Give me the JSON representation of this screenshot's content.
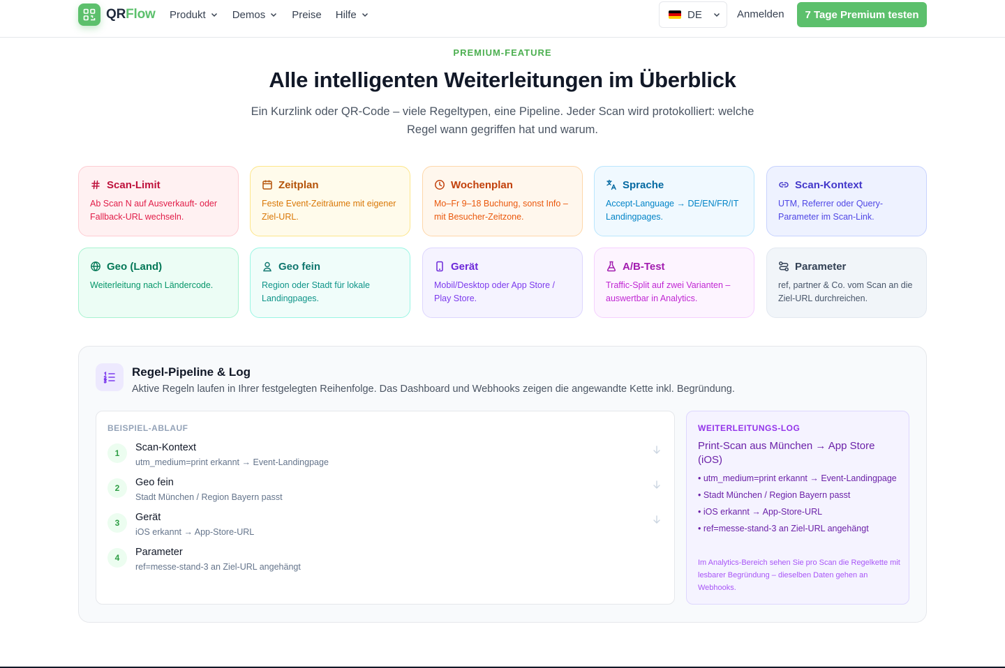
{
  "header": {
    "logo_left": "QR",
    "logo_right": "Flow",
    "nav": [
      {
        "label": "Produkt",
        "has_dropdown": true
      },
      {
        "label": "Demos",
        "has_dropdown": true
      },
      {
        "label": "Preise",
        "has_dropdown": false
      },
      {
        "label": "Hilfe",
        "has_dropdown": true
      }
    ],
    "language": "DE",
    "login": "Anmelden",
    "cta": "7 Tage Premium testen"
  },
  "hero": {
    "eyebrow": "PREMIUM-FEATURE",
    "title": "Alle intelligenten Weiterleitungen im Überblick",
    "subtitle": "Ein Kurzlink oder QR-Code – viele Regeltypen, eine Pipeline. Jeder Scan wird protokolliert: welche Regel wann gegriffen hat und warum."
  },
  "cards": [
    {
      "title": "Scan-Limit",
      "desc": "Ab Scan N auf Ausverkauft- oder Fallback-URL wechseln.",
      "icon": "hash-icon"
    },
    {
      "title": "Zeitplan",
      "desc": "Feste Event-Zeiträume mit eigener Ziel-URL.",
      "icon": "calendar-icon"
    },
    {
      "title": "Wochenplan",
      "desc": "Mo–Fr 9–18 Buchung, sonst Info – mit Besucher-Zeitzone.",
      "icon": "clock-icon"
    },
    {
      "title": "Sprache",
      "desc": "Accept-Language → DE/EN/FR/IT Landingpages.",
      "icon": "translate-icon"
    },
    {
      "title": "Scan-Kontext",
      "desc": "UTM, Referrer oder Query-Parameter im Scan-Link.",
      "icon": "link-icon"
    },
    {
      "title": "Geo (Land)",
      "desc": "Weiterleitung nach Ländercode.",
      "icon": "globe-icon"
    },
    {
      "title": "Geo fein",
      "desc": "Region oder Stadt für lokale Landingpages.",
      "icon": "location-user-icon"
    },
    {
      "title": "Gerät",
      "desc": "Mobil/Desktop oder App Store / Play Store.",
      "icon": "smartphone-icon"
    },
    {
      "title": "A/B-Test",
      "desc": "Traffic-Split auf zwei Varianten – auswertbar in Analytics.",
      "icon": "flask-icon"
    },
    {
      "title": "Parameter",
      "desc": "ref, partner & Co. vom Scan an die Ziel-URL durchreichen.",
      "icon": "route-icon"
    }
  ],
  "colors": {
    "brand": "#5cc06c",
    "card_themes": [
      {
        "bg": "#fff1f2",
        "border": "#fecdd3",
        "title": "#be123c",
        "text": "#e11d48"
      },
      {
        "bg": "#fffbeb",
        "border": "#fde68a",
        "title": "#b45309",
        "text": "#d97706"
      },
      {
        "bg": "#fff7ed",
        "border": "#fed7aa",
        "title": "#c2410c",
        "text": "#ea580c"
      },
      {
        "bg": "#f0f9ff",
        "border": "#bae6fd",
        "title": "#0369a1",
        "text": "#0284c7"
      },
      {
        "bg": "#eef2ff",
        "border": "#c7d2fe",
        "title": "#4338ca",
        "text": "#4f46e5"
      },
      {
        "bg": "#ecfdf5",
        "border": "#a7f3d0",
        "title": "#047857",
        "text": "#059669"
      },
      {
        "bg": "#f0fdfa",
        "border": "#99f6e4",
        "title": "#0f766e",
        "text": "#0d9488"
      },
      {
        "bg": "#f5f3ff",
        "border": "#ddd6fe",
        "title": "#6d28d9",
        "text": "#7c3aed"
      },
      {
        "bg": "#fdf4ff",
        "border": "#f5d0fe",
        "title": "#a21caf",
        "text": "#c026d3"
      },
      {
        "bg": "#f1f5f9",
        "border": "#e2e8f0",
        "title": "#334155",
        "text": "#475569"
      }
    ]
  },
  "pipeline": {
    "title": "Regel-Pipeline & Log",
    "desc": "Aktive Regeln laufen in Ihrer festgelegten Reihenfolge. Das Dashboard und Webhooks zeigen die angewandte Kette inkl. Begründung.",
    "flow_label": "BEISPIEL-ABLAUF",
    "steps": [
      {
        "num": "1",
        "title": "Scan-Kontext",
        "desc": "utm_medium=print erkannt → Event-Landingpage"
      },
      {
        "num": "2",
        "title": "Geo fein",
        "desc": "Stadt München / Region Bayern passt"
      },
      {
        "num": "3",
        "title": "Gerät",
        "desc": "iOS erkannt → App-Store-URL"
      },
      {
        "num": "4",
        "title": "Parameter",
        "desc": "ref=messe-stand-3 an Ziel-URL angehängt"
      }
    ],
    "log_label": "WEITERLEITUNGS-LOG",
    "log_title": "Print-Scan aus München → App Store (iOS)",
    "log_items": [
      "• utm_medium=print erkannt → Event-Landingpage",
      "• Stadt München / Region Bayern passt",
      "• iOS erkannt → App-Store-URL",
      "• ref=messe-stand-3 an Ziel-URL angehängt"
    ],
    "log_note": "Im Analytics-Bereich sehen Sie pro Scan die Regelkette mit lesbarer Begründung – dieselben Daten gehen an Webhooks."
  }
}
